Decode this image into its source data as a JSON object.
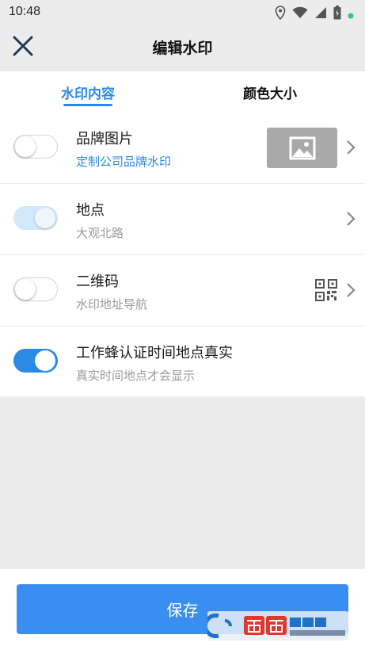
{
  "status_bar": {
    "time": "10:48",
    "icons": [
      "location-icon",
      "wifi-icon",
      "signal-icon",
      "battery-icon",
      "notification-dot-icon"
    ]
  },
  "app_bar": {
    "title": "编辑水印",
    "close_icon": "close-icon"
  },
  "tabs": [
    {
      "label": "水印内容",
      "active": true
    },
    {
      "label": "颜色大小",
      "active": false
    }
  ],
  "rows": [
    {
      "title": "品牌图片",
      "subtitle": "定制公司品牌水印",
      "toggle": "off",
      "trailing": "image-thumbnail"
    },
    {
      "title": "地点",
      "subtitle": "大观北路",
      "toggle": "light-on",
      "trailing": "chevron"
    },
    {
      "title": "二维码",
      "subtitle": "水印地址导航",
      "toggle": "off",
      "trailing": "qr-code"
    },
    {
      "title": "工作蜂认证时间地点真实",
      "subtitle": "真实时间地点才会显示",
      "toggle": "on",
      "trailing": "none"
    }
  ],
  "footer": {
    "save_label": "保存"
  },
  "watermark": {
    "logo_text": "西西软件园",
    "logo_url_text": "CR173.COM"
  },
  "colors": {
    "accent": "#2a8ae6",
    "button": "#3a8ef2",
    "background": "#ececec"
  }
}
